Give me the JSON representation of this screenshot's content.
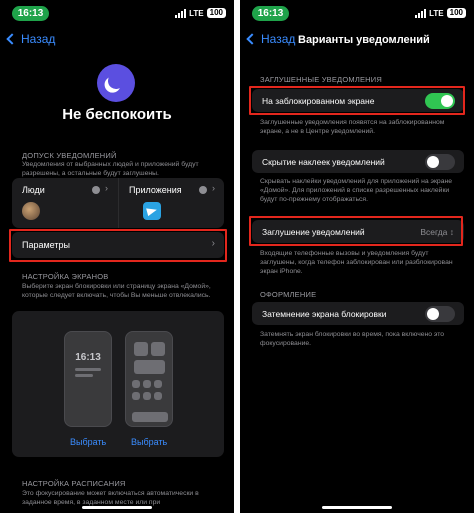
{
  "left": {
    "status": {
      "time": "16:13",
      "network": "LTE",
      "battery": "100"
    },
    "nav": {
      "back": "Назад"
    },
    "title": "Не беспокоить",
    "allow": {
      "header": "ДОПУСК УВЕДОМЛЕНИЙ",
      "desc": "Уведомления от выбранных людей и приложений будут разрешены, а остальные будут заглушены.",
      "people": "Люди",
      "apps": "Приложения",
      "params": "Параметры"
    },
    "screens": {
      "header": "НАСТРОЙКА ЭКРАНОВ",
      "desc": "Выберите экран блокировки или страницу экрана «Домой», которые следует включать, чтобы Вы меньше отвлекались.",
      "lock_time": "16:13",
      "choose1": "Выбрать",
      "choose2": "Выбрать"
    },
    "schedule": {
      "header": "НАСТРОЙКА РАСПИСАНИЯ",
      "desc": "Это фокусирование может включаться автоматически в заданное время, в заданном месте или при"
    }
  },
  "right": {
    "status": {
      "time": "16:13",
      "network": "LTE",
      "battery": "100"
    },
    "nav": {
      "back": "Назад",
      "title": "Варианты уведомлений"
    },
    "muted": {
      "header": "ЗАГЛУШЕННЫЕ УВЕДОМЛЕНИЯ",
      "lock_label": "На заблокированном экране",
      "lock_on": true,
      "lock_desc": "Заглушенные уведомления появятся на заблокированном экране, а не в Центре уведомлений.",
      "badges_label": "Скрытие наклеек уведомлений",
      "badges_on": false,
      "badges_desc": "Скрывать наклейки уведомлений для приложений на экране «Домой». Для приложений в списке разрешенных наклейки будут по-прежнему отображаться.",
      "silence_label": "Заглушение уведомлений",
      "silence_value": "Всегда",
      "silence_desc": "Входящие телефонные вызовы и уведомления будут заглушены, когда телефон заблокирован или разблокирован экран iPhone."
    },
    "appearance": {
      "header": "ОФОРМЛЕНИЕ",
      "dim_label": "Затемнение экрана блокировки",
      "dim_on": false,
      "dim_desc": "Затемнять экран блокировки во время, пока включено это фокусирование."
    }
  },
  "colors": {
    "accent": "#3a8cff",
    "toggle_on": "#30c552",
    "highlight": "#e3271d",
    "focus": "#5b4fe0"
  }
}
